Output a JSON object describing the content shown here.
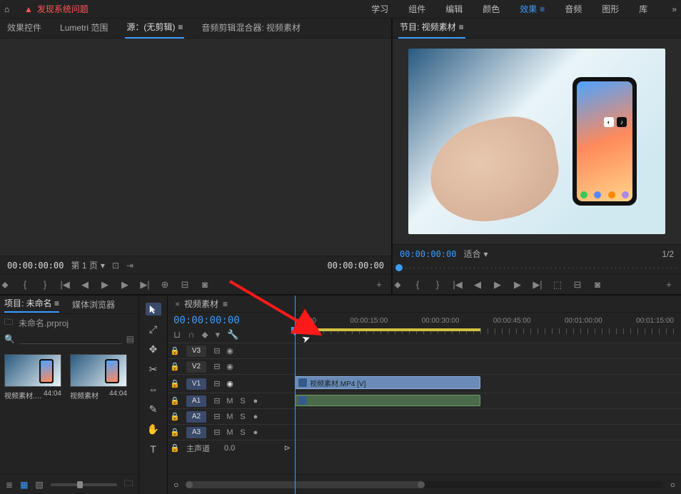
{
  "top": {
    "warning_text": "发现系统问题",
    "menu": [
      "学习",
      "组件",
      "编辑",
      "颜色",
      "效果",
      "音频",
      "图形",
      "库"
    ],
    "active_index": 4,
    "overflow": "»"
  },
  "source_panel": {
    "tabs": [
      "效果控件",
      "Lumetri 范围",
      "源：(无剪辑)",
      "音频剪辑混合器: 视频素材"
    ],
    "active_index": 2,
    "tc_left": "00:00:00:00",
    "page_dropdown": "第 1 页",
    "tc_right": "00:00:00:00"
  },
  "program_panel": {
    "title": "节目: 视频素材",
    "tc_left": "00:00:00:00",
    "fit_label": "适合",
    "fraction": "1/2"
  },
  "project": {
    "tabs": [
      "项目: 未命名",
      "媒体浏览器"
    ],
    "active_index": 0,
    "bin_name": "未命名.prproj",
    "search_placeholder": "",
    "items": [
      {
        "name": "视频素材.M…",
        "duration": "44:04"
      },
      {
        "name": "视频素材",
        "duration": "44:04"
      }
    ]
  },
  "tools": [
    "▲",
    "⤢",
    "✥",
    "✂",
    "⇔",
    "✎",
    "✋",
    "T"
  ],
  "timeline": {
    "title": "视频素材",
    "tc": "00:00:00:00",
    "ruler_labels": [
      "c00:00",
      "00:00:15:00",
      "00:00:30:00",
      "00:00:45:00",
      "00:01:00:00",
      "00:01:15:00"
    ],
    "tracks": {
      "video": [
        "V3",
        "V2",
        "V1"
      ],
      "audio": [
        "A1",
        "A2",
        "A3"
      ],
      "master": "主声道",
      "master_value": "0.0"
    },
    "toggle_labels": {
      "mute": "M",
      "solo": "S",
      "eye": "◉"
    },
    "clip_label": "视频素材.MP4 [V]"
  },
  "icons": {
    "home": "⌂",
    "warn": "▲",
    "lock": "🔒",
    "chevron": "▾",
    "menu": "≡",
    "magnify": "🔍",
    "bin": "🗀",
    "play": "▶",
    "step_back": "◀|",
    "step_fwd": "|▶",
    "mark_in": "{",
    "mark_out": "}",
    "camera": "◙",
    "plus": "+",
    "wrench": "🔧",
    "snap": "⊔",
    "link": "∩",
    "marker": "⬥",
    "closex": "×"
  }
}
